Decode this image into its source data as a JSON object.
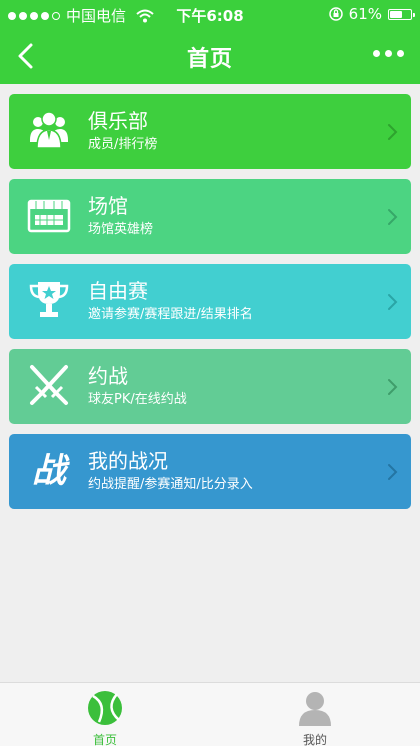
{
  "status_bar": {
    "carrier": "中国电信",
    "time": "下午6:08",
    "battery": "61%",
    "battery_level": 0.61
  },
  "nav": {
    "title": "首页"
  },
  "menu": {
    "items": [
      {
        "title": "俱乐部",
        "subtitle": "成员/排行榜",
        "icon": "club-members-icon",
        "color": "#3ecf3e"
      },
      {
        "title": "场馆",
        "subtitle": "场馆英雄榜",
        "icon": "stadium-icon",
        "color": "#4cd482"
      },
      {
        "title": "自由赛",
        "subtitle": "邀请参赛/赛程跟进/结果排名",
        "icon": "trophy-icon",
        "color": "#42cfd0"
      },
      {
        "title": "约战",
        "subtitle": "球友PK/在线约战",
        "icon": "crossed-swords-icon",
        "color": "#62cc95"
      },
      {
        "title": "我的战况",
        "subtitle": "约战提醒/参赛通知/比分录入",
        "icon": "battle-icon",
        "icon_text": "战",
        "color": "#3697cf"
      }
    ]
  },
  "tabbar": {
    "tabs": [
      {
        "label": "首页",
        "icon": "tennis-ball-icon",
        "active": true,
        "color": "#3bbf3b"
      },
      {
        "label": "我的",
        "icon": "user-avatar-icon",
        "active": false,
        "color": "#555555"
      }
    ]
  }
}
